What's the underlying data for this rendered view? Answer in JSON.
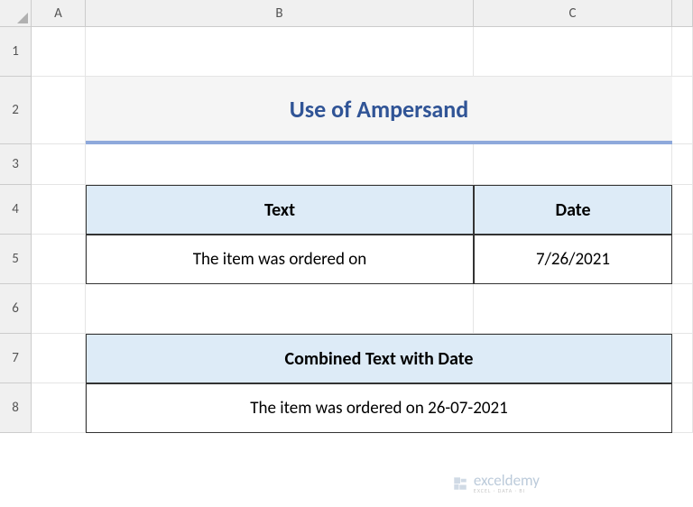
{
  "columns": {
    "a": "A",
    "b": "B",
    "c": "C"
  },
  "rows": {
    "r1": "1",
    "r2": "2",
    "r3": "3",
    "r4": "4",
    "r5": "5",
    "r6": "6",
    "r7": "7",
    "r8": "8"
  },
  "title": "Use of Ampersand",
  "table1": {
    "header_text": "Text",
    "header_date": "Date",
    "value_text": "The item was ordered on",
    "value_date": "7/26/2021"
  },
  "table2": {
    "header": "Combined Text with Date",
    "value": "The item was ordered on 26-07-2021"
  },
  "watermark": {
    "main": "exceldemy",
    "sub": "EXCEL · DATA · BI"
  }
}
